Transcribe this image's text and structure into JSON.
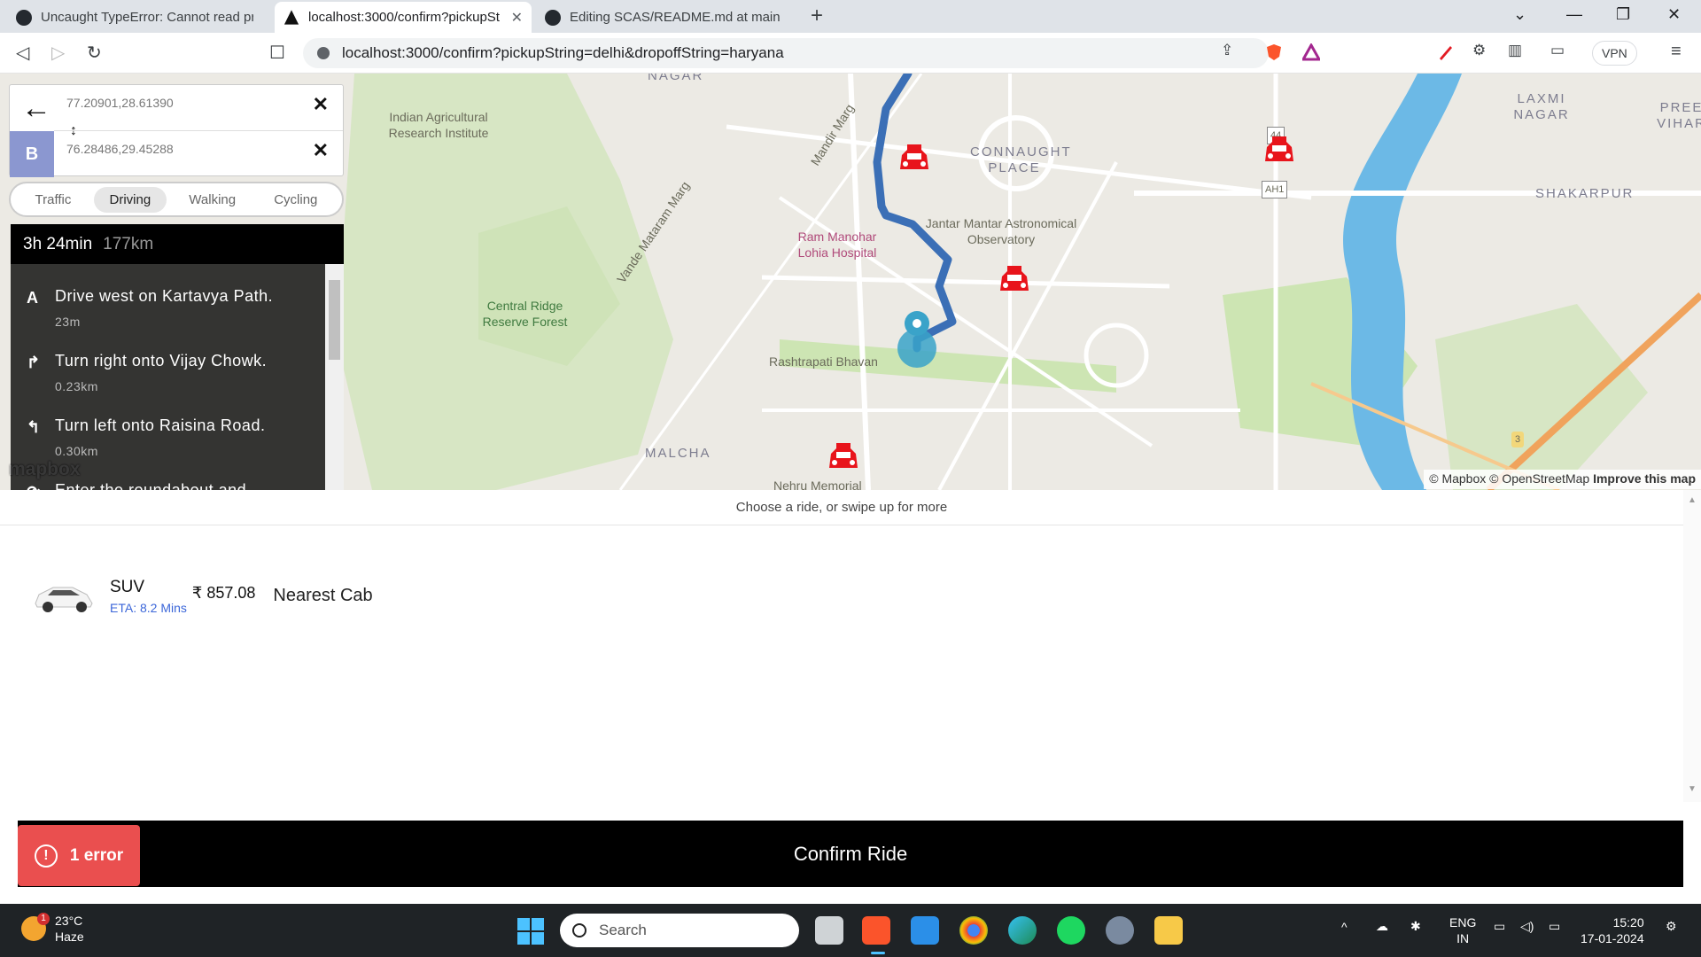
{
  "browser": {
    "tabs": [
      {
        "title": "Uncaught TypeError: Cannot read prop",
        "active": false
      },
      {
        "title": "localhost:3000/confirm?pickupSt",
        "active": true
      },
      {
        "title": "Editing SCAS/README.md at main · N",
        "active": false
      }
    ],
    "new_tab": "+",
    "url": "localhost:3000/confirm?pickupString=delhi&dropoffString=haryana",
    "vpn_label": "VPN"
  },
  "map": {
    "labels": [
      "NAGAR",
      "Indian Agricultural Research Institute",
      "Mandir Marg",
      "CONNAUGHT PLACE",
      "LAXMI NAGAR",
      "PREE VIHAR",
      "Vande Mataram Marg",
      "Ram Manohar Lohia Hospital",
      "Jantar Mantar Astronomical Observatory",
      "SHAKARPUR",
      "Central Ridge Reserve Forest",
      "Rashtrapati Bhavan",
      "MALCHA",
      "Nehru Memorial",
      "AH1",
      "44",
      "3"
    ],
    "attribution": "© Mapbox © OpenStreetMap",
    "improve_link": "Improve this map",
    "logo": "mapbox",
    "colors": {
      "route": "#3b6fb6",
      "marker": "#3aa3c9",
      "car": "#e8141b",
      "river": "#5fb4e3",
      "park": "#cde5b3"
    }
  },
  "directions": {
    "origin": "77.20901,28.61390",
    "destination": "76.28486,29.45288",
    "destination_marker": "B",
    "profiles": [
      "Traffic",
      "Driving",
      "Walking",
      "Cycling"
    ],
    "active_profile": "Driving",
    "duration": "3h 24min",
    "distance": "177km",
    "steps": [
      {
        "icon": "A",
        "text": "Drive west on Kartavya Path.",
        "distance": "23m"
      },
      {
        "icon": "↱",
        "text": "Turn right onto Vijay Chowk.",
        "distance": "0.23km"
      },
      {
        "icon": "↰",
        "text": "Turn left onto Raisina Road.",
        "distance": "0.30km"
      },
      {
        "icon": "⟳",
        "text": "Enter the roundabout and",
        "distance": ""
      }
    ]
  },
  "ride": {
    "prompt": "Choose a ride, or swipe up for more",
    "options": [
      {
        "name": "SUV",
        "eta": "ETA: 8.2 Mins",
        "price": "₹ 857.08",
        "tag": "Nearest Cab"
      }
    ],
    "confirm_label": "Confirm Ride",
    "error_label": "1 error",
    "error_icon": "!"
  },
  "taskbar": {
    "weather_temp": "23°C",
    "weather_desc": "Haze",
    "weather_badge": "1",
    "search_label": "Search",
    "lang_1": "ENG",
    "lang_2": "IN",
    "time": "15:20",
    "date": "17-01-2024"
  }
}
